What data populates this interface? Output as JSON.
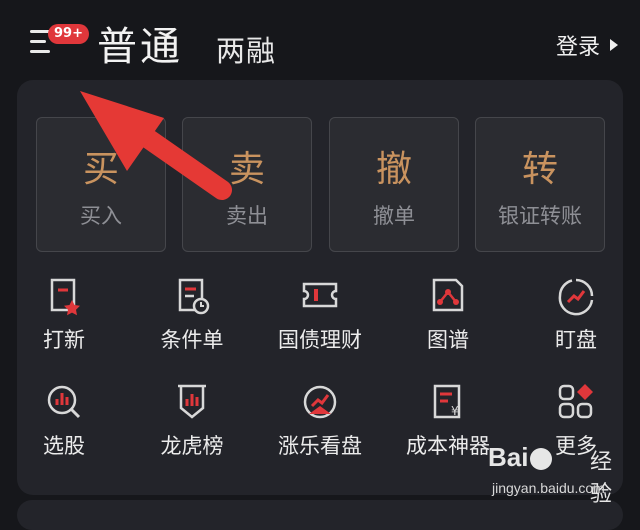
{
  "header": {
    "badge": "99+",
    "tab_normal": "普通",
    "tab_margin": "两融",
    "login": "登录"
  },
  "trade_actions": [
    {
      "big": "买",
      "small": "买入"
    },
    {
      "big": "卖",
      "small": "卖出"
    },
    {
      "big": "撤",
      "small": "撤单"
    },
    {
      "big": "转",
      "small": "银证转账"
    }
  ],
  "grid": {
    "row1": [
      "打新",
      "条件单",
      "国债理财",
      "图谱",
      "盯盘"
    ],
    "row2": [
      "选股",
      "龙虎榜",
      "涨乐看盘",
      "成本神器",
      "更多"
    ]
  },
  "watermark": {
    "logo_left": "Bai",
    "logo_right": "",
    "cn": "经验",
    "url": "jingyan.baidu.com"
  },
  "colors": {
    "accent_red": "#e0373b",
    "gold": "#c9935f",
    "background": "#16171b",
    "panel": "#23242a"
  },
  "icons": {
    "row1": [
      "ipo-icon",
      "condition-order-icon",
      "bond-icon",
      "graph-icon",
      "watch-icon"
    ],
    "row2": [
      "stock-picker-icon",
      "dragon-tiger-icon",
      "gauge-icon",
      "cost-tool-icon",
      "more-icon"
    ]
  }
}
